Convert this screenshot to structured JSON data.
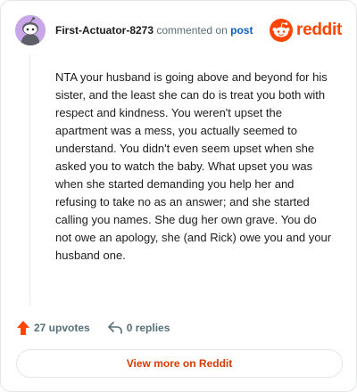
{
  "comment": {
    "author": "First-Actuator-8273",
    "action_text": "commented on",
    "post_link": "post",
    "avatar_icon": "snoo-avatar-icon",
    "body": "NTA your husband is going above and beyond for his sister, and the least she can do is treat you both with respect and kindness. You weren't upset the apartment was a mess, you actually seemed to understand. You didn't even seem upset when she asked you to watch the baby. What upset you was when she started demanding you help her and refusing to take no as an answer; and she started calling you names. She dug her own grave. You do not owe an apology, she (and Rick) owe you and your husband one."
  },
  "brand": {
    "name": "reddit",
    "icon": "reddit-logo-icon",
    "color": "#ff4500"
  },
  "actions": {
    "upvotes": "27 upvotes",
    "replies": "0 replies",
    "upvote_icon": "upvote-arrow-icon",
    "reply_icon": "reply-arrow-icon",
    "upvote_color": "#ff4500"
  },
  "footer": {
    "view_more": "View more on Reddit",
    "link_color": "#d93a00"
  }
}
